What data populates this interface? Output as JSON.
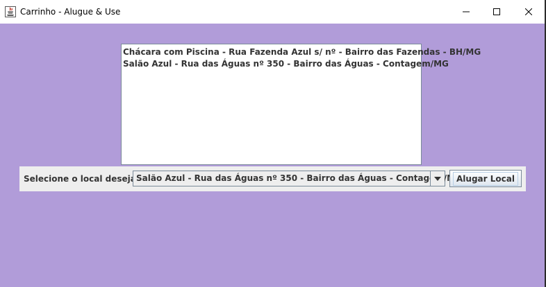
{
  "window": {
    "title": "Carrinho - Alugue & Use",
    "icon": "java-cup-icon"
  },
  "controls": {
    "minimize_icon": "minimize-icon",
    "maximize_icon": "maximize-icon",
    "close_icon": "close-icon"
  },
  "list": {
    "items": [
      "Chácara com Piscina - Rua Fazenda Azul s/ nº - Bairro das Fazendas - BH/MG",
      "Salão Azul - Rua das Águas nº 350 - Bairro das Águas - Contagem/MG"
    ]
  },
  "form": {
    "select_label": "Selecione o local desejado:",
    "selected_value": "Salão Azul - Rua das Águas nº 350 - Bairro das Águas - Contagem/MG",
    "button_label": "Alugar Local"
  },
  "colors": {
    "background": "#b19cd9",
    "panel": "#eeeeee",
    "text": "#333333"
  }
}
